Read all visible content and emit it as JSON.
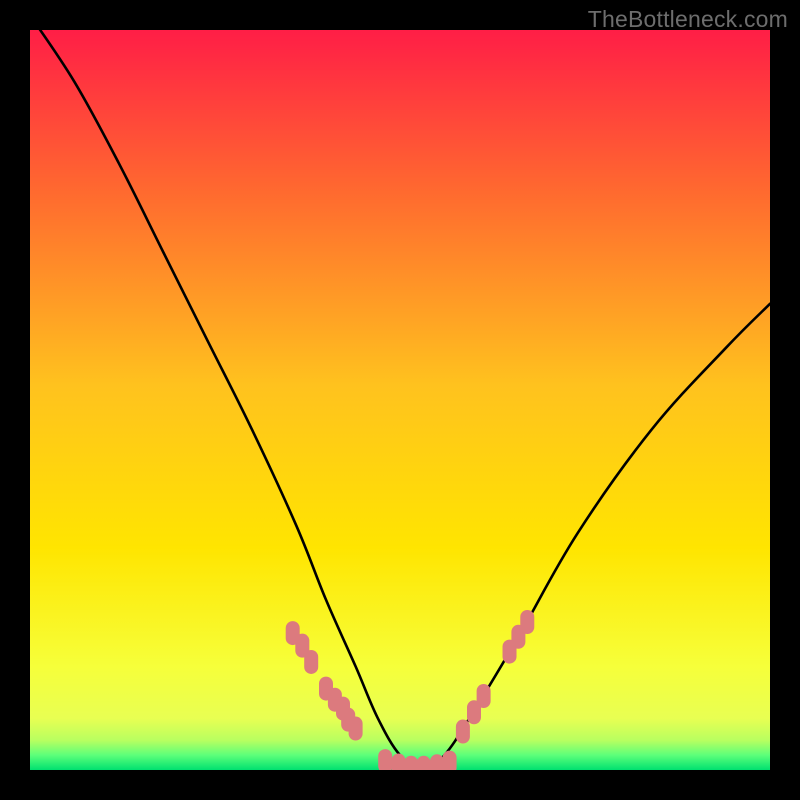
{
  "watermark": "TheBottleneck.com",
  "chart_data": {
    "type": "line",
    "title": "",
    "xlabel": "",
    "ylabel": "",
    "xlim": [
      0,
      100
    ],
    "ylim": [
      0,
      100
    ],
    "background_gradient": {
      "0": "#FF1E46",
      "50": "#FFE500",
      "94": "#E8FF52",
      "98": "#5CFF7A",
      "100": "#00E070"
    },
    "series": [
      {
        "name": "bottleneck-curve",
        "type": "curve",
        "x": [
          0,
          6,
          12,
          18,
          24,
          30,
          36,
          40,
          44,
          47,
          50,
          53,
          56,
          60,
          66,
          74,
          84,
          94,
          100
        ],
        "y": [
          102,
          93,
          82,
          70,
          58,
          46,
          33,
          23,
          14,
          7,
          2,
          0,
          2,
          8,
          18,
          32,
          46,
          57,
          63
        ]
      },
      {
        "name": "left-band-markers",
        "type": "scatter",
        "x": [
          35.5,
          36.8,
          38.0,
          40.0,
          41.2,
          42.3,
          43.0,
          44.0
        ],
        "y": [
          18.5,
          16.8,
          14.6,
          11.0,
          9.5,
          8.3,
          6.8,
          5.6
        ]
      },
      {
        "name": "bottom-markers",
        "type": "scatter",
        "x": [
          48.0,
          49.8,
          51.5,
          53.2,
          55.0,
          56.7
        ],
        "y": [
          1.2,
          0.6,
          0.3,
          0.3,
          0.5,
          1.0
        ]
      },
      {
        "name": "right-band-markers",
        "type": "scatter",
        "x": [
          58.5,
          60.0,
          61.3,
          64.8,
          66.0,
          67.2
        ],
        "y": [
          5.2,
          7.8,
          10.0,
          16.0,
          18.0,
          20.0
        ]
      }
    ],
    "marker_color": "#DC7A7E",
    "curve_color": "#000000"
  }
}
